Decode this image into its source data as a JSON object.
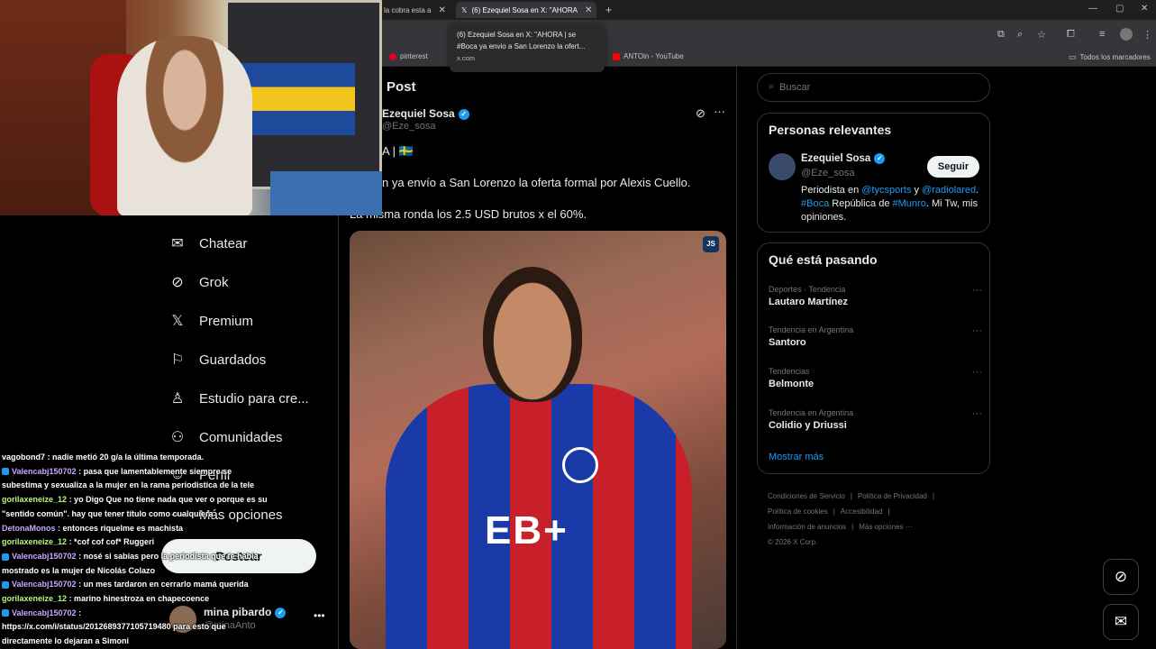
{
  "browser": {
    "tabs": [
      {
        "label": "la cobra esta a"
      },
      {
        "label": "(6) Ezequiel Sosa en X: \"AHORA"
      }
    ],
    "new_tab_symbol": "+",
    "close_symbol": "✕",
    "tooltip": {
      "line1": "(6) Ezequiel Sosa en X: \"AHORA | se",
      "line2": "#Boca ya envio a San Lorenzo la ofert...",
      "url": "x.com"
    },
    "bookmarks": [
      {
        "label": "pinterest"
      },
      {
        "label": "ANTOin - YouTube"
      }
    ],
    "all_bookmarks": "Todos los marcadores"
  },
  "sidebar": {
    "items": [
      {
        "label": "Chatear",
        "icon": "envelope-icon"
      },
      {
        "label": "Grok",
        "icon": "grok-icon"
      },
      {
        "label": "Premium",
        "icon": "x-logo-icon"
      },
      {
        "label": "Guardados",
        "icon": "bookmark-icon"
      },
      {
        "label": "Estudio para cre...",
        "icon": "studio-icon"
      },
      {
        "label": "Comunidades",
        "icon": "communities-icon"
      },
      {
        "label": "Perfil",
        "icon": "profile-icon"
      },
      {
        "label": "Más opciones",
        "icon": "more-icon"
      }
    ],
    "post_button": "Postear",
    "account": {
      "name": "mina pibardo",
      "handle": "@minaAnto"
    }
  },
  "post": {
    "header": "Post",
    "author_name": "Ezequiel Sosa",
    "author_handle": "@Eze_sosa",
    "line1": "A | 🇸🇪",
    "line2": "n ya envío a San Lorenzo la oferta formal por Alexis Cuello.",
    "line3": "La misma ronda los 2.5 USD brutos x el 60%.",
    "image_badge": "JS",
    "image_sponsor": "EB+"
  },
  "right": {
    "search_placeholder": "Buscar",
    "relevant": {
      "title": "Personas relevantes",
      "name": "Ezequiel Sosa",
      "handle": "@Eze_sosa",
      "follow_label": "Seguir",
      "bio_parts": {
        "p1": "Periodista en ",
        "l1": "@tycsports",
        "p2": " y ",
        "l2": "@radiolared",
        "p3": ". ",
        "l3": "#Boca",
        "p4": " República de ",
        "l4": "#Munro",
        "p5": ". Mi Tw, mis opiniones."
      }
    },
    "trending": {
      "title": "Qué está pasando",
      "items": [
        {
          "category": "Deportes · Tendencia",
          "topic": "Lautaro Martínez"
        },
        {
          "category": "Tendencia en Argentina",
          "topic": "Santoro"
        },
        {
          "category": "Tendencias",
          "topic": "Belmonte"
        },
        {
          "category": "Tendencia en Argentina",
          "topic": "Colidio y Driussi"
        }
      ],
      "show_more": "Mostrar más"
    },
    "footer": {
      "links": [
        "Condiciones de Servicio",
        "Política de Privacidad",
        "Política de cookies",
        "Accesibilidad",
        "Información de anuncios",
        "Más opciones ···"
      ],
      "copyright": "© 2026 X Corp."
    }
  },
  "chat": [
    {
      "user": "vagobond7",
      "text": ": nadie metió 20 g/a la última temporada.",
      "color": "#ffffff"
    },
    {
      "user": "Valencabj150702",
      "text": ": pasa que lamentablemente siempre se subestima y sexualiza a la mujer en la rama periodistica de la tele",
      "color": "#c9a8ff"
    },
    {
      "user": "gorilaxeneize_12",
      "text": ": yo Digo Que no tiene nada que ver o porque es su \"sentido común\". hay que tener título como cualquiera",
      "color": "#b7f77a"
    },
    {
      "user": "DetonaMonos",
      "text": ": entonces riquelme es machista",
      "color": "#c9a8ff"
    },
    {
      "user": "gorilaxeneize_12",
      "text": ": *cof cof cof* Ruggeri",
      "color": "#b7f77a"
    },
    {
      "user": "Valencabj150702",
      "text": ": nosé si sabías pero la periodista que te había mostrado es la mujer de Nicolás Colazo",
      "color": "#c9a8ff"
    },
    {
      "user": "Valencabj150702",
      "text": ": un mes tardaron en cerrarlo mamá querida",
      "color": "#c9a8ff"
    },
    {
      "user": "gorilaxeneize_12",
      "text": ": marino hinestroza en chapecoence",
      "color": "#b7f77a"
    },
    {
      "user": "Valencabj150702",
      "text": ":",
      "color": "#c9a8ff"
    },
    {
      "user": "",
      "text": "https://x.com/i/status/2012689377105719480 para esto que directamente lo dejaran a Simoni",
      "color": "#ffffff"
    }
  ]
}
